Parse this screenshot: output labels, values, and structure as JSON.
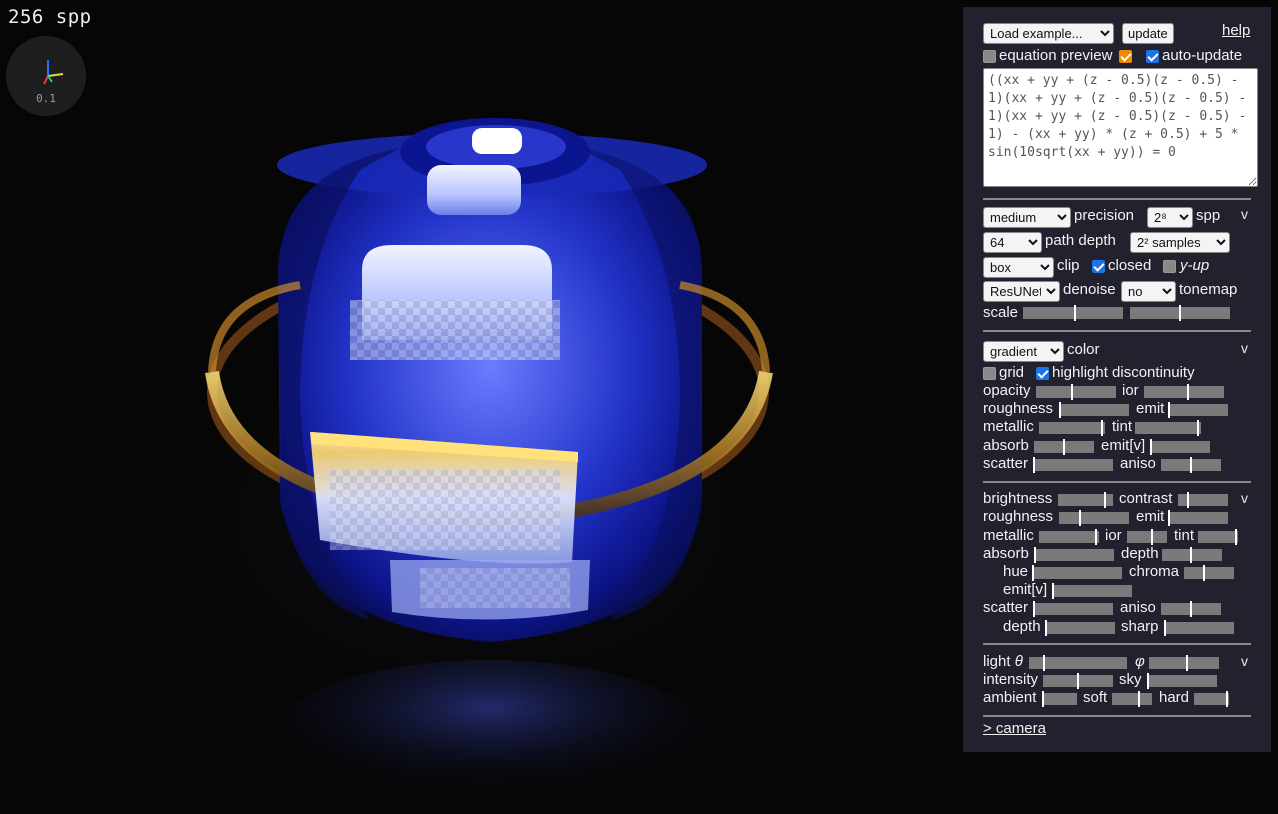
{
  "render": {
    "spp_text": "256 spp",
    "axis_scale": "0.1"
  },
  "toolbar": {
    "load_example": "Load example...",
    "update_label": "update",
    "help_label": "help",
    "equation_preview_label": "equation preview",
    "auto_update_label": "auto-update"
  },
  "equation": "((xx + yy + (z - 0.5)(z - 0.5) - 1)(xx + yy + (z - 0.5)(z - 0.5) - 1)(xx + yy + (z - 0.5)(z - 0.5) - 1) - (xx + yy) * (z + 0.5) + 5 * sin(10sqrt(xx + yy)) = 0",
  "render_settings": {
    "precision_value": "medium",
    "precision_label": "precision",
    "spp_value": "2⁸",
    "spp_label": "spp",
    "path_depth_value": "64",
    "path_depth_label": "path depth",
    "samples_value": "2² samples",
    "clip_value": "box",
    "clip_label": "clip",
    "closed_label": "closed",
    "yup_label": "y-up",
    "denoise_value": "ResUNet",
    "denoise_label": "denoise",
    "tonemap_value": "no",
    "tonemap_label": "tonemap",
    "scale_label": "scale",
    "collapse": "v"
  },
  "material": {
    "color_mode": "gradient",
    "color_label": "color",
    "grid_label": "grid",
    "highlight_label": "highlight discontinuity",
    "opacity": "opacity",
    "ior": "ior",
    "roughness": "roughness",
    "emit": "emit",
    "metallic": "metallic",
    "tint": "tint",
    "absorb": "absorb",
    "emitv": "emit[v]",
    "scatter": "scatter",
    "aniso": "aniso",
    "collapse": "v"
  },
  "material2": {
    "brightness": "brightness",
    "contrast": "contrast",
    "roughness": "roughness",
    "emit": "emit",
    "metallic": "metallic",
    "ior": "ior",
    "tint": "tint",
    "absorb": "absorb",
    "depth": "depth",
    "hue": "hue",
    "chroma": "chroma",
    "emitv": "emit[v]",
    "scatter": "scatter",
    "aniso": "aniso",
    "depth2": "depth",
    "sharp": "sharp",
    "collapse": "v"
  },
  "lighting": {
    "light": "light",
    "theta": "θ",
    "phi": "φ",
    "intensity": "intensity",
    "sky": "sky",
    "ambient": "ambient",
    "soft": "soft",
    "hard": "hard",
    "collapse": "v"
  },
  "camera_link": "> camera",
  "sliders": {
    "scale_a": 0.52,
    "scale_b": 0.5,
    "opacity": 0.45,
    "ior": 0.55,
    "roughness1": 0.0,
    "emit1": 0.0,
    "metallic1": 0.97,
    "tint1": 0.97,
    "absorb1": 0.5,
    "emitv1": 0.0,
    "scatter1": 0.0,
    "aniso1": 0.5,
    "brightness": 0.87,
    "contrast": 0.18,
    "roughness2": 0.3,
    "emit2": 0.0,
    "metallic2": 0.97,
    "ior2": 0.62,
    "tint2": 0.97,
    "absorb2": 0.0,
    "depth1": 0.48,
    "hue": 0.0,
    "chroma": 0.4,
    "emitv2": 0.0,
    "scatter2": 0.0,
    "aniso2": 0.5,
    "depth2": 0.0,
    "sharp": 0.0,
    "theta": 0.15,
    "phi": 0.55,
    "intensity": 0.5,
    "sky": 0.0,
    "ambient": 0.0,
    "soft": 0.68,
    "hard": 0.97
  }
}
